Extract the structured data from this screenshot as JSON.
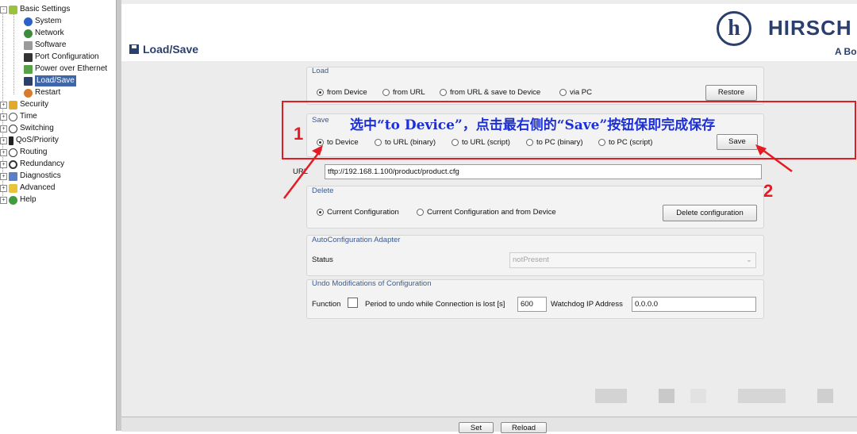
{
  "tree": {
    "items": [
      {
        "label": "Basic Settings",
        "icon": "star-icon"
      },
      {
        "label": "System",
        "icon": "info-icon"
      },
      {
        "label": "Network",
        "icon": "network-icon"
      },
      {
        "label": "Software",
        "icon": "software-icon"
      },
      {
        "label": "Port Configuration",
        "icon": "port-icon"
      },
      {
        "label": "Power over Ethernet",
        "icon": "poe-icon"
      },
      {
        "label": "Load/Save",
        "icon": "floppy-icon"
      },
      {
        "label": "Restart",
        "icon": "restart-icon"
      },
      {
        "label": "Security",
        "icon": "lock-icon"
      },
      {
        "label": "Time",
        "icon": "clock-icon"
      },
      {
        "label": "Switching",
        "icon": "switch-icon"
      },
      {
        "label": "QoS/Priority",
        "icon": "qos-icon"
      },
      {
        "label": "Routing",
        "icon": "routing-icon"
      },
      {
        "label": "Redundancy",
        "icon": "redundancy-icon"
      },
      {
        "label": "Diagnostics",
        "icon": "diagnostics-icon"
      },
      {
        "label": "Advanced",
        "icon": "advanced-icon"
      },
      {
        "label": "Help",
        "icon": "help-icon"
      }
    ]
  },
  "header": {
    "title": "Load/Save",
    "logo_mark": "h",
    "logo_text": "HIRSCH",
    "logo_sub": "A Bo"
  },
  "load": {
    "legend": "Load",
    "options": [
      "from Device",
      "from URL",
      "from URL & save to Device",
      "via PC"
    ],
    "selected": "from Device",
    "button": "Restore"
  },
  "save": {
    "legend": "Save",
    "options": [
      "to Device",
      "to URL (binary)",
      "to URL (script)",
      "to PC (binary)",
      "to PC (script)"
    ],
    "selected": "to Device",
    "button": "Save"
  },
  "url": {
    "label": "URL",
    "value": "tftp://192.168.1.100/product/product.cfg"
  },
  "delete": {
    "legend": "Delete",
    "options": [
      "Current Configuration",
      "Current Configuration and from Device"
    ],
    "selected": "Current Configuration",
    "button": "Delete configuration"
  },
  "autoconfig": {
    "legend": "AutoConfiguration Adapter",
    "status_label": "Status",
    "status_value": "notPresent"
  },
  "undo": {
    "legend": "Undo Modifications of Configuration",
    "function_label": "Function",
    "period_label": "Period to undo while Connection is lost [s]",
    "period_value": "600",
    "watchdog_label": "Watchdog IP Address",
    "watchdog_value": "0.0.0.0"
  },
  "annotation": {
    "text": "选中“to Device”，点击最右侧的“Save”按钮保即完成保存",
    "step1": "1",
    "step2": "2",
    "color_box": "#e31b23",
    "color_text": "#1d2fd6"
  },
  "footer": {
    "set_label": "Set",
    "reload_label": "Reload"
  }
}
